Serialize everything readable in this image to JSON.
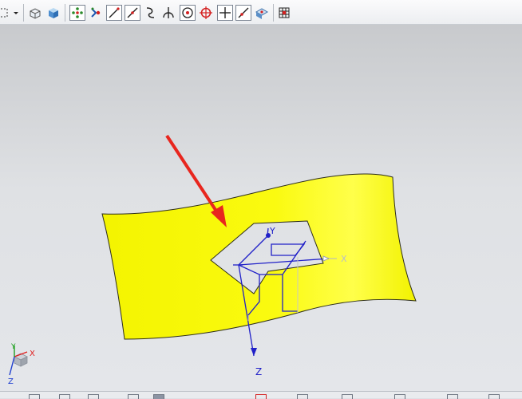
{
  "toolbar": {
    "buttons": [
      {
        "name": "select-box-icon"
      },
      {
        "name": "dropdown-arrow-icon"
      },
      {
        "name": "wireframe-box-icon"
      },
      {
        "name": "shaded-box-icon"
      },
      {
        "name": "snap-endpoint-icon",
        "active": true
      },
      {
        "name": "snap-control-point-icon"
      },
      {
        "name": "snap-line-icon",
        "active": true
      },
      {
        "name": "snap-point-on-curve-icon",
        "active": true
      },
      {
        "name": "snap-curve-icon"
      },
      {
        "name": "snap-intersection-icon"
      },
      {
        "name": "snap-arc-center-icon",
        "active": true
      },
      {
        "name": "snap-quadrant-icon"
      },
      {
        "name": "snap-existing-point-icon",
        "active": true
      },
      {
        "name": "snap-point-on-line-icon",
        "active": true
      },
      {
        "name": "snap-face-icon"
      },
      {
        "name": "grid-icon"
      }
    ]
  },
  "scene": {
    "surface_color": "#f7f700",
    "csys_color": "#1e1ecc",
    "arrow_color": "#e8261e",
    "csys_axes": {
      "x": "X",
      "y": "Y",
      "z": "Z"
    },
    "triad_axes": {
      "x": "X",
      "y": "Y",
      "z": "Z"
    }
  }
}
